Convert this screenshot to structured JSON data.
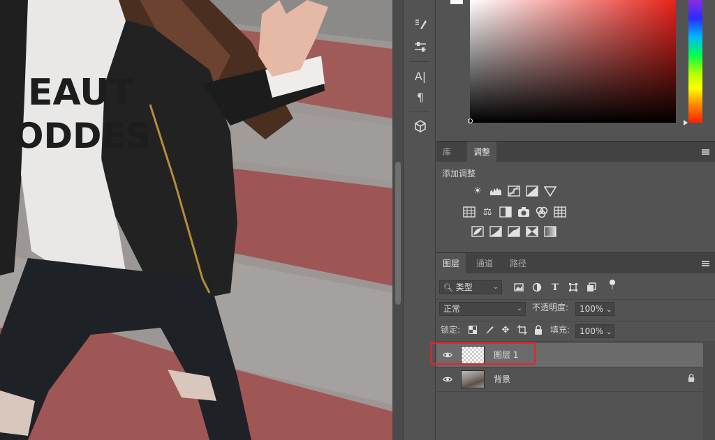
{
  "colors": {
    "panel_bg": "#535353",
    "header_bg": "#424242",
    "selected_row": "#6b6b6b",
    "highlight": "#e8232a",
    "picker_hue": "#e8231b"
  },
  "canvas": {
    "shirt_text_line1": "EAUT",
    "shirt_text_line2": "ODDES"
  },
  "toolstrip": {
    "tools": [
      "brush-settings-icon",
      "adjust-sliders-icon",
      "character-icon",
      "paragraph-icon",
      "3d-cube-icon"
    ]
  },
  "adjustments_panel": {
    "tabs": [
      {
        "label": "库",
        "active": false
      },
      {
        "label": "调整",
        "active": true
      }
    ],
    "title": "添加调整",
    "icons_row1": [
      "brightness-contrast-icon",
      "levels-icon",
      "curves-icon",
      "exposure-icon",
      "vibrance-icon"
    ],
    "icons_row2": [
      "hue-saturation-icon",
      "color-balance-icon",
      "black-white-icon",
      "photo-filter-icon",
      "channel-mixer-icon",
      "color-lookup-icon"
    ],
    "icons_row3": [
      "invert-icon",
      "posterize-icon",
      "threshold-icon",
      "selective-color-icon",
      "gradient-map-icon"
    ]
  },
  "layers_panel": {
    "tabs": [
      {
        "label": "图层",
        "active": true
      },
      {
        "label": "通道",
        "active": false
      },
      {
        "label": "路径",
        "active": false
      }
    ],
    "filter": {
      "label": "类型"
    },
    "blend_mode": "正常",
    "opacity_label": "不透明度:",
    "opacity_value": "100%",
    "lock_label": "锁定:",
    "fill_label": "填充:",
    "fill_value": "100%",
    "layers": [
      {
        "name": "图层 1",
        "visible": true,
        "selected": true,
        "thumbnail": "transparent",
        "locked": false
      },
      {
        "name": "背景",
        "visible": true,
        "selected": false,
        "thumbnail": "photo",
        "locked": true
      }
    ]
  }
}
